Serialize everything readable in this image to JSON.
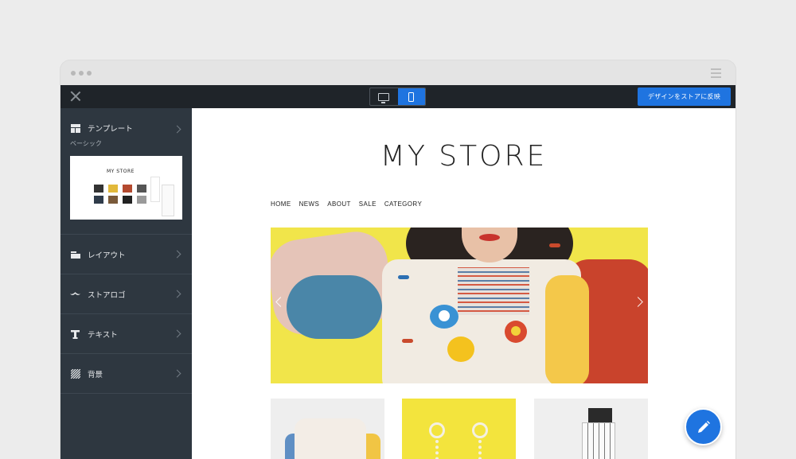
{
  "toolbar": {
    "apply_label": "デザインをストアに反映",
    "device_modes": [
      "desktop",
      "mobile"
    ],
    "active_device": "mobile"
  },
  "sidebar": {
    "template": {
      "label": "テンプレート",
      "current": "ベーシック",
      "icon": "template-icon"
    },
    "items": [
      {
        "label": "レイアウト",
        "icon": "layout-icon"
      },
      {
        "label": "ストアロゴ",
        "icon": "mustache-logo-icon"
      },
      {
        "label": "テキスト",
        "icon": "text-t-icon"
      },
      {
        "label": "背景",
        "icon": "background-stripes-icon"
      }
    ]
  },
  "preview": {
    "store_title": "MY STORE",
    "thumb_title": "MY STORE",
    "nav": [
      "HOME",
      "NEWS",
      "ABOUT",
      "SALE",
      "CATEGORY"
    ]
  },
  "colors": {
    "accent": "#1f74e0",
    "topbar": "#1f2429",
    "sidebar": "#2e3740"
  }
}
